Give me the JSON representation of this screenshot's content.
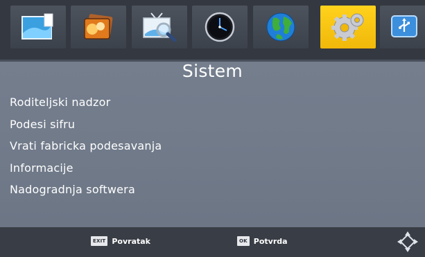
{
  "topbar": {
    "tabs": [
      {
        "icon": "picture-frame-icon",
        "active": false
      },
      {
        "icon": "photo-stack-icon",
        "active": false
      },
      {
        "icon": "tv-search-icon",
        "active": false
      },
      {
        "icon": "clock-icon",
        "active": false
      },
      {
        "icon": "globe-icon",
        "active": false
      },
      {
        "icon": "gears-icon",
        "active": true
      },
      {
        "icon": "usb-icon",
        "active": false
      }
    ],
    "active_color": "#ffd21c"
  },
  "page": {
    "title": "Sistem"
  },
  "menu": {
    "items": [
      {
        "label": "Roditeljski nadzor"
      },
      {
        "label": "Podesi sifru"
      },
      {
        "label": "Vrati fabricka podesavanja"
      },
      {
        "label": "Informacije"
      },
      {
        "label": "Nadogradnja softwera"
      }
    ]
  },
  "footer": {
    "back": {
      "key": "EXIT",
      "label": "Povratak"
    },
    "ok": {
      "key": "OK",
      "label": "Potvrda"
    },
    "nav_icon": "navigation-diamond-icon"
  }
}
